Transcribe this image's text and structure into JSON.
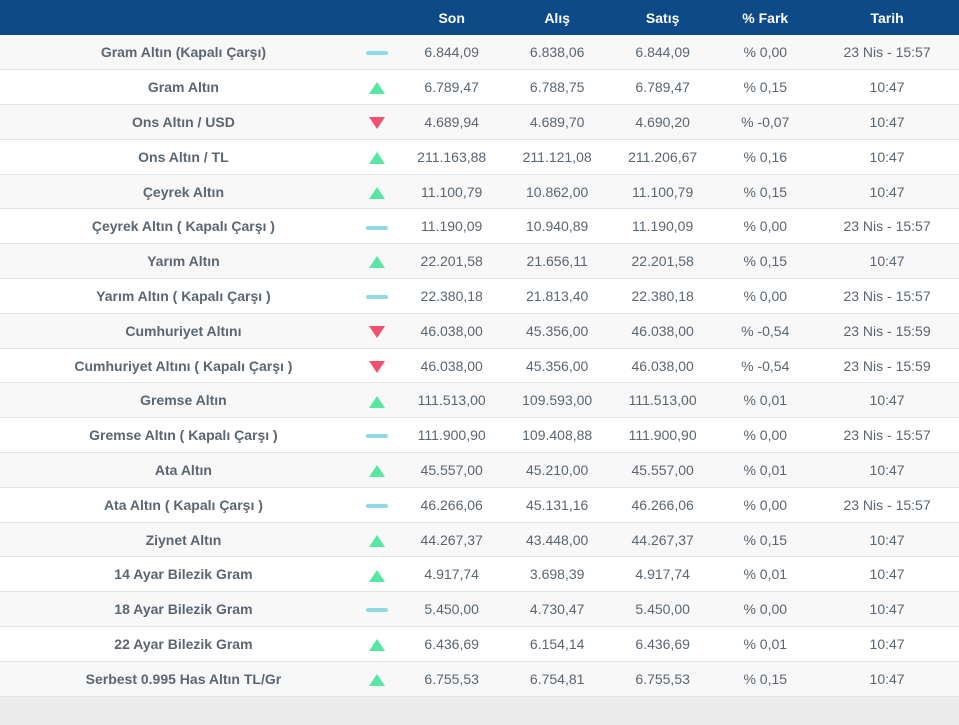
{
  "table": {
    "headers": {
      "son": "Son",
      "alis": "Alış",
      "satis": "Satış",
      "fark": "% Fark",
      "tarih": "Tarih"
    },
    "rows": [
      {
        "name": "Gram Altın (Kapalı Çarşı)",
        "trend": "flat",
        "son": "6.844,09",
        "alis": "6.838,06",
        "satis": "6.844,09",
        "fark": "% 0,00",
        "tarih": "23 Nis - 15:57"
      },
      {
        "name": "Gram Altın",
        "trend": "up",
        "son": "6.789,47",
        "alis": "6.788,75",
        "satis": "6.789,47",
        "fark": "% 0,15",
        "tarih": "10:47"
      },
      {
        "name": "Ons Altın / USD",
        "trend": "down",
        "son": "4.689,94",
        "alis": "4.689,70",
        "satis": "4.690,20",
        "fark": "% -0,07",
        "tarih": "10:47"
      },
      {
        "name": "Ons Altın / TL",
        "trend": "up",
        "son": "211.163,88",
        "alis": "211.121,08",
        "satis": "211.206,67",
        "fark": "% 0,16",
        "tarih": "10:47"
      },
      {
        "name": "Çeyrek Altın",
        "trend": "up",
        "son": "11.100,79",
        "alis": "10.862,00",
        "satis": "11.100,79",
        "fark": "% 0,15",
        "tarih": "10:47"
      },
      {
        "name": "Çeyrek Altın ( Kapalı Çarşı )",
        "trend": "flat",
        "son": "11.190,09",
        "alis": "10.940,89",
        "satis": "11.190,09",
        "fark": "% 0,00",
        "tarih": "23 Nis - 15:57"
      },
      {
        "name": "Yarım Altın",
        "trend": "up",
        "son": "22.201,58",
        "alis": "21.656,11",
        "satis": "22.201,58",
        "fark": "% 0,15",
        "tarih": "10:47"
      },
      {
        "name": "Yarım Altın ( Kapalı Çarşı )",
        "trend": "flat",
        "son": "22.380,18",
        "alis": "21.813,40",
        "satis": "22.380,18",
        "fark": "% 0,00",
        "tarih": "23 Nis - 15:57"
      },
      {
        "name": "Cumhuriyet Altını",
        "trend": "down",
        "son": "46.038,00",
        "alis": "45.356,00",
        "satis": "46.038,00",
        "fark": "% -0,54",
        "tarih": "23 Nis - 15:59"
      },
      {
        "name": "Cumhuriyet Altını ( Kapalı Çarşı )",
        "trend": "down",
        "son": "46.038,00",
        "alis": "45.356,00",
        "satis": "46.038,00",
        "fark": "% -0,54",
        "tarih": "23 Nis - 15:59"
      },
      {
        "name": "Gremse Altın",
        "trend": "up",
        "son": "111.513,00",
        "alis": "109.593,00",
        "satis": "111.513,00",
        "fark": "% 0,01",
        "tarih": "10:47"
      },
      {
        "name": "Gremse Altın ( Kapalı Çarşı )",
        "trend": "flat",
        "son": "111.900,90",
        "alis": "109.408,88",
        "satis": "111.900,90",
        "fark": "% 0,00",
        "tarih": "23 Nis - 15:57"
      },
      {
        "name": "Ata Altın",
        "trend": "up",
        "son": "45.557,00",
        "alis": "45.210,00",
        "satis": "45.557,00",
        "fark": "% 0,01",
        "tarih": "10:47"
      },
      {
        "name": "Ata Altın ( Kapalı Çarşı )",
        "trend": "flat",
        "son": "46.266,06",
        "alis": "45.131,16",
        "satis": "46.266,06",
        "fark": "% 0,00",
        "tarih": "23 Nis - 15:57"
      },
      {
        "name": "Ziynet Altın",
        "trend": "up",
        "son": "44.267,37",
        "alis": "43.448,00",
        "satis": "44.267,37",
        "fark": "% 0,15",
        "tarih": "10:47"
      },
      {
        "name": "14 Ayar Bilezik Gram",
        "trend": "up",
        "son": "4.917,74",
        "alis": "3.698,39",
        "satis": "4.917,74",
        "fark": "% 0,01",
        "tarih": "10:47"
      },
      {
        "name": "18 Ayar Bilezik Gram",
        "trend": "flat",
        "son": "5.450,00",
        "alis": "4.730,47",
        "satis": "5.450,00",
        "fark": "% 0,00",
        "tarih": "10:47"
      },
      {
        "name": "22 Ayar Bilezik Gram",
        "trend": "up",
        "son": "6.436,69",
        "alis": "6.154,14",
        "satis": "6.436,69",
        "fark": "% 0,01",
        "tarih": "10:47"
      },
      {
        "name": "Serbest 0.995 Has Altın TL/Gr",
        "trend": "up",
        "son": "6.755,53",
        "alis": "6.754,81",
        "satis": "6.755,53",
        "fark": "% 0,15",
        "tarih": "10:47"
      }
    ]
  },
  "colors": {
    "header_bg": "#0e4a87",
    "header_text": "#ffffff",
    "name_color": "#22318f",
    "value_color": "#5a6670",
    "row_alt_bg": "#f8f8f9",
    "up_color": "#58e6a3",
    "down_color": "#f4506e",
    "flat_color": "#8fdae3",
    "page_bg": "#ececed"
  }
}
